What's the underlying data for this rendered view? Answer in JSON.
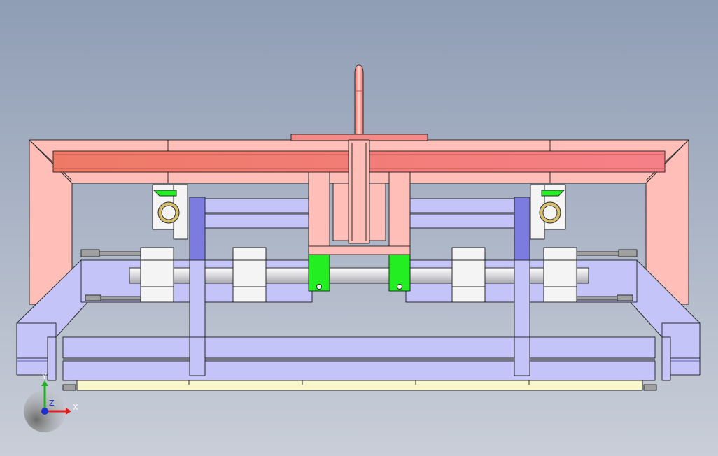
{
  "viewport": {
    "background_top": "#8f9db5",
    "background_bottom": "#c9ced8"
  },
  "colors": {
    "frame_pink": "#ffbfb8",
    "beam_red": "#f07868",
    "beam_red_light": "#f68a86",
    "rail_lavender": "#c4c4f8",
    "rail_dark": "#7c7ce0",
    "bearing_white": "#f4f4f4",
    "shaft_gray": "#d8d8dc",
    "clamp_green": "#22ee22",
    "base_cream": "#fbf7cc",
    "pin_gray": "#a0a0a0",
    "outline": "#2b2b2b",
    "axis_x": "#e02020",
    "axis_y": "#20b020",
    "axis_z": "#2030d0"
  },
  "triad": {
    "x_label": "X",
    "y_label": "Y",
    "z_label": "Z"
  }
}
